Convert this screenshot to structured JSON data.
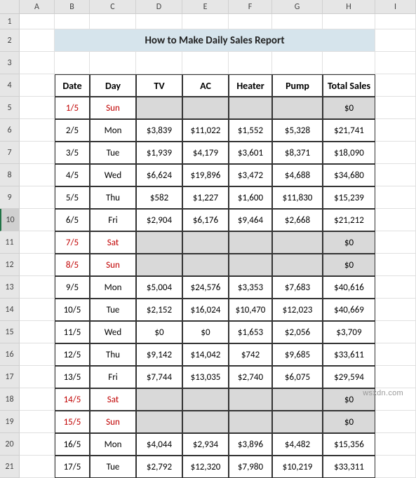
{
  "columns": [
    "A",
    "B",
    "C",
    "D",
    "E",
    "F",
    "G",
    "H",
    "I"
  ],
  "row_numbers": [
    "1",
    "2",
    "3",
    "4",
    "5",
    "6",
    "7",
    "8",
    "9",
    "10",
    "11",
    "12",
    "13",
    "14",
    "15",
    "16",
    "17",
    "18",
    "19",
    "20",
    "21"
  ],
  "selected_row": 10,
  "title": "How to Make Daily Sales Report",
  "headers": {
    "date": "Date",
    "day": "Day",
    "tv": "TV",
    "ac": "AC",
    "heater": "Heater",
    "pump": "Pump",
    "total": "Total Sales"
  },
  "rows": [
    {
      "date": "1/5",
      "day": "Sun",
      "tv": "",
      "ac": "",
      "heater": "",
      "pump": "",
      "total": "$0",
      "red": true,
      "grey": true
    },
    {
      "date": "2/5",
      "day": "Mon",
      "tv": "$3,839",
      "ac": "$11,022",
      "heater": "$1,552",
      "pump": "$5,328",
      "total": "$21,741"
    },
    {
      "date": "3/5",
      "day": "Tue",
      "tv": "$1,939",
      "ac": "$4,179",
      "heater": "$3,601",
      "pump": "$8,371",
      "total": "$18,090"
    },
    {
      "date": "4/5",
      "day": "Wed",
      "tv": "$6,624",
      "ac": "$19,896",
      "heater": "$3,472",
      "pump": "$4,688",
      "total": "$34,680"
    },
    {
      "date": "5/5",
      "day": "Thu",
      "tv": "$582",
      "ac": "$1,227",
      "heater": "$1,600",
      "pump": "$11,830",
      "total": "$15,239"
    },
    {
      "date": "6/5",
      "day": "Fri",
      "tv": "$2,904",
      "ac": "$6,176",
      "heater": "$9,464",
      "pump": "$2,668",
      "total": "$21,212"
    },
    {
      "date": "7/5",
      "day": "Sat",
      "tv": "",
      "ac": "",
      "heater": "",
      "pump": "",
      "total": "$0",
      "red": true,
      "grey": true
    },
    {
      "date": "8/5",
      "day": "Sun",
      "tv": "",
      "ac": "",
      "heater": "",
      "pump": "",
      "total": "$0",
      "red": true,
      "grey": true
    },
    {
      "date": "9/5",
      "day": "Mon",
      "tv": "$5,004",
      "ac": "$24,576",
      "heater": "$3,353",
      "pump": "$7,683",
      "total": "$40,616"
    },
    {
      "date": "10/5",
      "day": "Tue",
      "tv": "$2,152",
      "ac": "$16,024",
      "heater": "$10,470",
      "pump": "$12,023",
      "total": "$40,669"
    },
    {
      "date": "11/5",
      "day": "Wed",
      "tv": "$0",
      "ac": "$0",
      "heater": "$1,653",
      "pump": "$2,056",
      "total": "$3,709"
    },
    {
      "date": "12/5",
      "day": "Thu",
      "tv": "$9,142",
      "ac": "$14,042",
      "heater": "$742",
      "pump": "$9,685",
      "total": "$33,611"
    },
    {
      "date": "13/5",
      "day": "Fri",
      "tv": "$7,744",
      "ac": "$13,035",
      "heater": "$2,740",
      "pump": "$6,075",
      "total": "$29,594"
    },
    {
      "date": "14/5",
      "day": "Sat",
      "tv": "",
      "ac": "",
      "heater": "",
      "pump": "",
      "total": "$0",
      "red": true,
      "grey": true
    },
    {
      "date": "15/5",
      "day": "Sun",
      "tv": "",
      "ac": "",
      "heater": "",
      "pump": "",
      "total": "$0",
      "red": true,
      "grey": true
    },
    {
      "date": "16/5",
      "day": "Mon",
      "tv": "$4,044",
      "ac": "$2,934",
      "heater": "$3,896",
      "pump": "$4,482",
      "total": "$15,356"
    },
    {
      "date": "17/5",
      "day": "Tue",
      "tv": "$2,792",
      "ac": "$12,320",
      "heater": "$7,980",
      "pump": "$10,219",
      "total": "$33,311"
    }
  ],
  "watermark": "wsxdn.com",
  "chart_data": {
    "type": "table",
    "title": "How to Make Daily Sales Report",
    "columns": [
      "Date",
      "Day",
      "TV",
      "AC",
      "Heater",
      "Pump",
      "Total Sales"
    ],
    "rows": [
      [
        "1/5",
        "Sun",
        null,
        null,
        null,
        null,
        0
      ],
      [
        "2/5",
        "Mon",
        3839,
        11022,
        1552,
        5328,
        21741
      ],
      [
        "3/5",
        "Tue",
        1939,
        4179,
        3601,
        8371,
        18090
      ],
      [
        "4/5",
        "Wed",
        6624,
        19896,
        3472,
        4688,
        34680
      ],
      [
        "5/5",
        "Thu",
        582,
        1227,
        1600,
        11830,
        15239
      ],
      [
        "6/5",
        "Fri",
        2904,
        6176,
        9464,
        2668,
        21212
      ],
      [
        "7/5",
        "Sat",
        null,
        null,
        null,
        null,
        0
      ],
      [
        "8/5",
        "Sun",
        null,
        null,
        null,
        null,
        0
      ],
      [
        "9/5",
        "Mon",
        5004,
        24576,
        3353,
        7683,
        40616
      ],
      [
        "10/5",
        "Tue",
        2152,
        16024,
        10470,
        12023,
        40669
      ],
      [
        "11/5",
        "Wed",
        0,
        0,
        1653,
        2056,
        3709
      ],
      [
        "12/5",
        "Thu",
        9142,
        14042,
        742,
        9685,
        33611
      ],
      [
        "13/5",
        "Fri",
        7744,
        13035,
        2740,
        6075,
        29594
      ],
      [
        "14/5",
        "Sat",
        null,
        null,
        null,
        null,
        0
      ],
      [
        "15/5",
        "Sun",
        null,
        null,
        null,
        null,
        0
      ],
      [
        "16/5",
        "Mon",
        4044,
        2934,
        3896,
        4482,
        15356
      ],
      [
        "17/5",
        "Tue",
        2792,
        12320,
        7980,
        10219,
        33311
      ]
    ]
  }
}
